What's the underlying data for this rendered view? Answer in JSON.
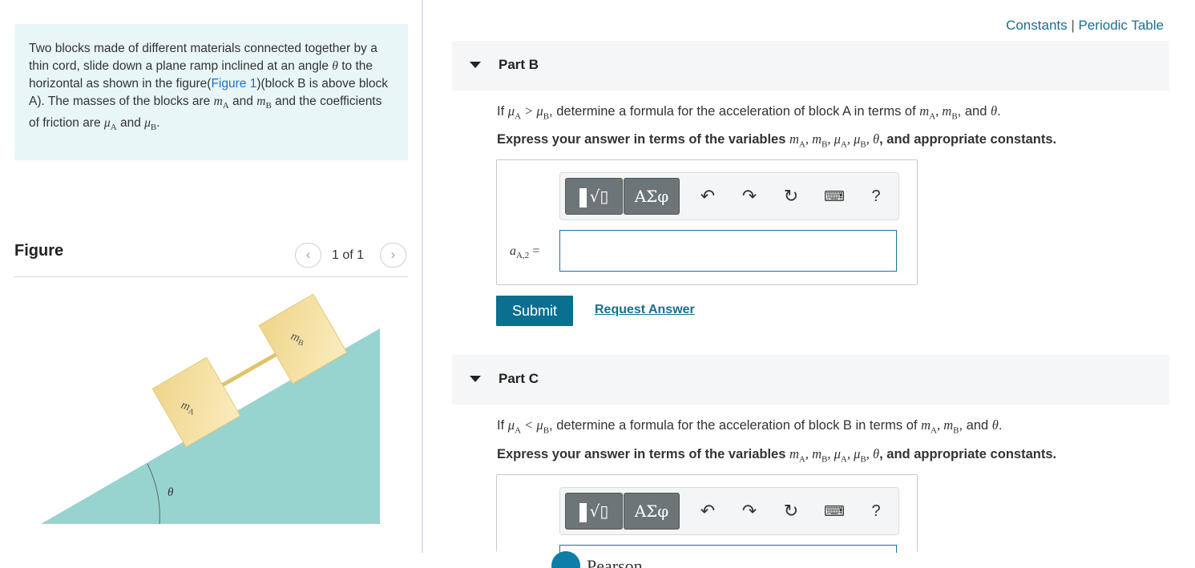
{
  "problem": {
    "text_1": "Two blocks made of different materials connected together by a thin cord, slide down a plane ramp inclined at an angle ",
    "theta": "θ",
    "text_2": " to the horizontal as shown in the figure(",
    "figure_link": "Figure 1",
    "text_3": ")(block B is above block A). The masses of the blocks are ",
    "mA": "m",
    "mA_sub": "A",
    "and_1": " and ",
    "mB": "m",
    "mB_sub": "B",
    "text_4": " and the coefficients of friction are ",
    "muA": "μ",
    "muA_sub": "A",
    "and_2": " and ",
    "muB": "μ",
    "muB_sub": "B",
    "end": "."
  },
  "figure": {
    "title": "Figure",
    "pager_text": "1 of 1",
    "prev_icon": "chevron-left-icon",
    "next_icon": "chevron-right-icon",
    "label_mA": "m",
    "label_mA_sub": "A",
    "label_mB": "m",
    "label_mB_sub": "B",
    "label_theta": "θ",
    "ramp_color": "#97d3cf",
    "block_color": "#f4dc8d"
  },
  "top_links": {
    "constants": "Constants",
    "separator": "|",
    "periodic_table": "Periodic Table"
  },
  "part_b": {
    "title": "Part B",
    "question_prefix": "If ",
    "condition": "μA > μB",
    "question_mid": ", determine a formula for the acceleration of block A in terms of ",
    "vars": "mA, mB",
    "question_and": ", and ",
    "theta": "θ",
    "question_end": ".",
    "instruction_prefix": "Express your answer in terms of the variables ",
    "instruction_vars": "mA, mB, μA, μB, θ",
    "instruction_suffix": ", and appropriate constants.",
    "var_label": "aA,2",
    "equals": "=",
    "answer_value": "",
    "submit_label": "Submit",
    "request_label": "Request Answer"
  },
  "part_c": {
    "title": "Part C",
    "question_prefix": "If ",
    "condition": "μA < μB",
    "question_mid": ", determine a formula for the acceleration of block B in terms of ",
    "vars": "mA, mB",
    "question_and": ", and ",
    "theta": "θ",
    "question_end": ".",
    "instruction_prefix": "Express your answer in terms of the variables ",
    "instruction_vars": "mA, mB, μA, μB, θ",
    "instruction_suffix": ", and appropriate constants."
  },
  "toolbar": {
    "template_label": "√▯",
    "greek_label": "ΑΣφ",
    "undo_icon": "undo-icon",
    "redo_icon": "redo-icon",
    "reset_icon": "reset-icon",
    "keyboard_icon": "keyboard-icon",
    "help_label": "?"
  },
  "footer": {
    "logo_text": "Pearson"
  }
}
